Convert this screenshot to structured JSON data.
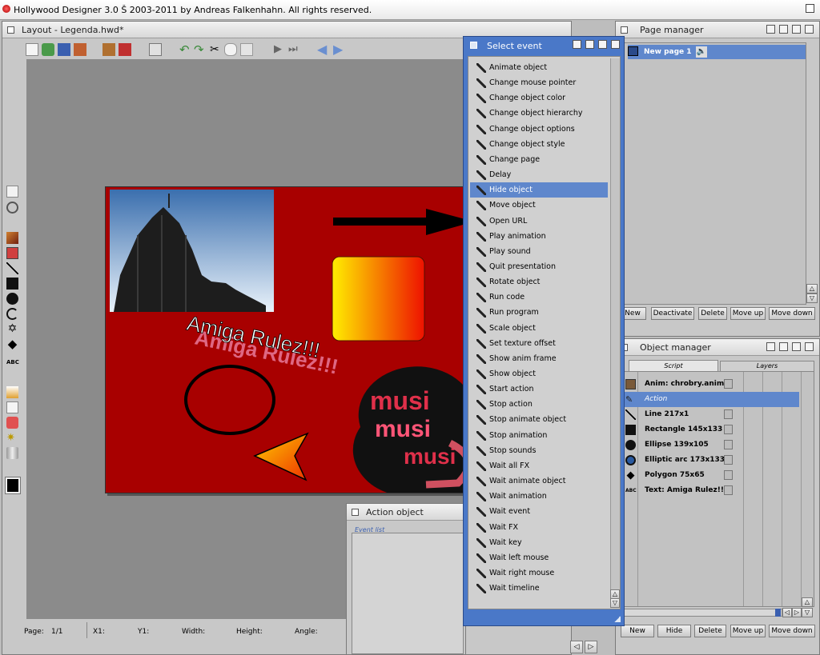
{
  "app": {
    "title": "Hollywood Designer 3.0 Š 2003-2011 by Andreas Falkenhahn. All rights reserved."
  },
  "layout_window": {
    "title": "Layout - Legenda.hwd*"
  },
  "canvas": {
    "text": "Amiga Rulez!!!",
    "shadow_text": "Amiga Rulez!!!",
    "music_text": "musi"
  },
  "status_bar": {
    "page_label": "Page:",
    "page_value": "1/1",
    "x_label": "X1:",
    "y_label": "Y1:",
    "width_label": "Width:",
    "height_label": "Height:",
    "angle_label": "Angle:"
  },
  "select_event": {
    "title": "Select event",
    "items": [
      "Animate object",
      "Change mouse pointer",
      "Change object color",
      "Change object hierarchy",
      "Change object options",
      "Change object style",
      "Change page",
      "Delay",
      "Hide object",
      "Move object",
      "Open URL",
      "Play animation",
      "Play sound",
      "Quit presentation",
      "Rotate object",
      "Run code",
      "Run program",
      "Scale object",
      "Set texture offset",
      "Show anim frame",
      "Show object",
      "Start action",
      "Stop action",
      "Stop animate object",
      "Stop animation",
      "Stop sounds",
      "Wait all FX",
      "Wait animate object",
      "Wait animation",
      "Wait event",
      "Wait FX",
      "Wait key",
      "Wait left mouse",
      "Wait right mouse",
      "Wait timeline"
    ],
    "selected": "Hide object"
  },
  "page_manager": {
    "title": "Page manager",
    "row_label": "New page 1",
    "buttons": {
      "new": "New",
      "deactivate": "Deactivate",
      "delete": "Delete",
      "move_up": "Move up",
      "move_down": "Move down"
    }
  },
  "object_manager": {
    "title": "Object manager",
    "tabs": {
      "script": "Script",
      "layers": "Layers"
    },
    "rows": [
      {
        "label": "Anim: chrobry.anim",
        "icon": "anim-icon"
      },
      {
        "label": "Action",
        "icon": "pen-icon"
      },
      {
        "label": "Line 217x1",
        "icon": "line-icon"
      },
      {
        "label": "Rectangle 145x133",
        "icon": "rectangle-icon"
      },
      {
        "label": "Ellipse 139x105",
        "icon": "ellipse-icon"
      },
      {
        "label": "Elliptic arc 173x133",
        "icon": "arc-icon"
      },
      {
        "label": "Polygon 75x65",
        "icon": "polygon-icon"
      },
      {
        "label": "Text: Amiga Rulez!!!",
        "icon": "text-icon"
      }
    ],
    "side_icon_label": "ABC",
    "buttons": {
      "new": "New",
      "hide": "Hide",
      "delete": "Delete",
      "move_up": "Move up",
      "move_down": "Move down"
    }
  },
  "action_object": {
    "title": "Action object",
    "event_list_label": "Event list"
  },
  "tools": {
    "text_tool_label": "ABC"
  },
  "colors": {
    "canvas_red": "#a80000",
    "selection_blue": "#5f87cc",
    "event_window_border": "#4a78c8"
  }
}
